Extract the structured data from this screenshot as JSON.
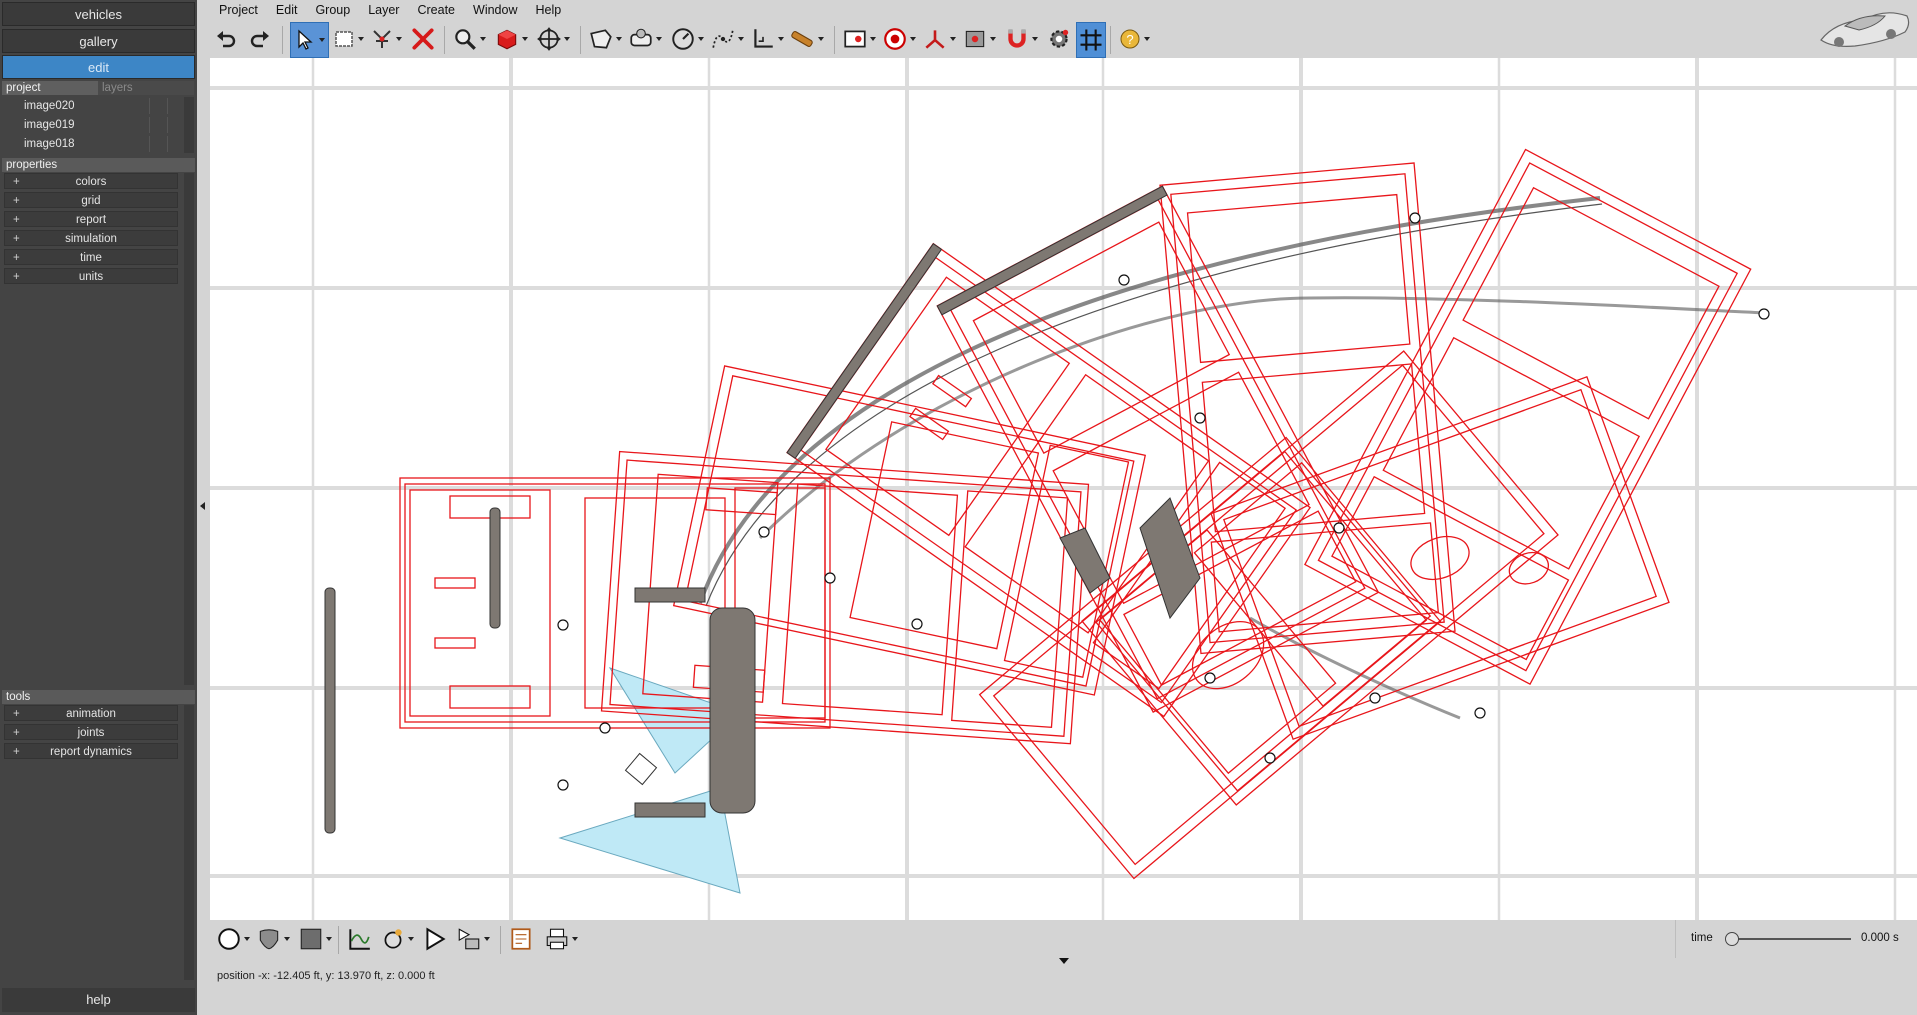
{
  "left_panel": {
    "nav": [
      "vehicles",
      "gallery",
      "edit"
    ],
    "tabs": {
      "project": "project",
      "layers": "layers"
    },
    "layers": [
      "image020",
      "image019",
      "image018"
    ],
    "properties_title": "properties",
    "properties": [
      "colors",
      "grid",
      "report",
      "simulation",
      "time",
      "units"
    ],
    "tools_title": "tools",
    "tools": [
      "animation",
      "joints",
      "report dynamics"
    ],
    "plus": "+",
    "help": "help"
  },
  "menu": [
    "Project",
    "Edit",
    "Group",
    "Layer",
    "Create",
    "Window",
    "Help"
  ],
  "toolbar_icons": [
    "undo-icon",
    "redo-icon",
    "select-arrow-icon",
    "rectangle-select-icon",
    "split-icon",
    "delete-icon",
    "zoom-icon",
    "cube-icon",
    "pan-icon",
    "shape-icon",
    "stamp-icon",
    "gauge-icon",
    "curve-icon",
    "axes-icon",
    "measure-icon",
    "target-frame-icon",
    "record-icon",
    "vector-icon",
    "image-icon",
    "magnet-icon",
    "settings-icon",
    "grid-icon",
    "help-icon"
  ],
  "bottom_icons": [
    "circle-icon",
    "shield-icon",
    "square-icon",
    "graph-icon",
    "camera-icon",
    "play-icon",
    "frames-icon",
    "report-icon",
    "print-icon"
  ],
  "status": {
    "position": "position -x: -12.405 ft, y: 13.970 ft, z: 0.000 ft"
  },
  "time": {
    "label": "time",
    "value": "0.000 s",
    "slider_fraction": 0.0
  },
  "colors": {
    "accent": "#3d86c6",
    "panel": "#444444",
    "vehicle_outline": "#e8161b",
    "trajectory": "#444444",
    "sensor_fill": "#bfe9f6"
  }
}
